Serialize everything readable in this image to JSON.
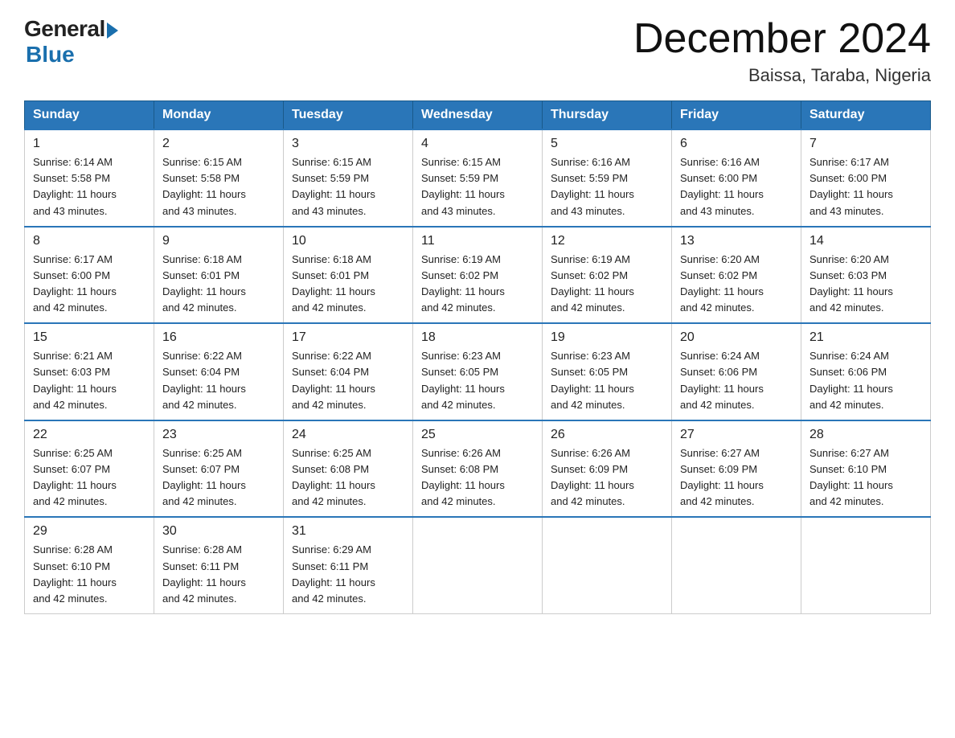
{
  "logo": {
    "general": "General",
    "blue": "Blue",
    "subtitle": "Blue"
  },
  "header": {
    "month_year": "December 2024",
    "location": "Baissa, Taraba, Nigeria"
  },
  "weekdays": [
    "Sunday",
    "Monday",
    "Tuesday",
    "Wednesday",
    "Thursday",
    "Friday",
    "Saturday"
  ],
  "weeks": [
    [
      {
        "day": "1",
        "sunrise": "6:14 AM",
        "sunset": "5:58 PM",
        "daylight": "11 hours and 43 minutes."
      },
      {
        "day": "2",
        "sunrise": "6:15 AM",
        "sunset": "5:58 PM",
        "daylight": "11 hours and 43 minutes."
      },
      {
        "day": "3",
        "sunrise": "6:15 AM",
        "sunset": "5:59 PM",
        "daylight": "11 hours and 43 minutes."
      },
      {
        "day": "4",
        "sunrise": "6:15 AM",
        "sunset": "5:59 PM",
        "daylight": "11 hours and 43 minutes."
      },
      {
        "day": "5",
        "sunrise": "6:16 AM",
        "sunset": "5:59 PM",
        "daylight": "11 hours and 43 minutes."
      },
      {
        "day": "6",
        "sunrise": "6:16 AM",
        "sunset": "6:00 PM",
        "daylight": "11 hours and 43 minutes."
      },
      {
        "day": "7",
        "sunrise": "6:17 AM",
        "sunset": "6:00 PM",
        "daylight": "11 hours and 43 minutes."
      }
    ],
    [
      {
        "day": "8",
        "sunrise": "6:17 AM",
        "sunset": "6:00 PM",
        "daylight": "11 hours and 42 minutes."
      },
      {
        "day": "9",
        "sunrise": "6:18 AM",
        "sunset": "6:01 PM",
        "daylight": "11 hours and 42 minutes."
      },
      {
        "day": "10",
        "sunrise": "6:18 AM",
        "sunset": "6:01 PM",
        "daylight": "11 hours and 42 minutes."
      },
      {
        "day": "11",
        "sunrise": "6:19 AM",
        "sunset": "6:02 PM",
        "daylight": "11 hours and 42 minutes."
      },
      {
        "day": "12",
        "sunrise": "6:19 AM",
        "sunset": "6:02 PM",
        "daylight": "11 hours and 42 minutes."
      },
      {
        "day": "13",
        "sunrise": "6:20 AM",
        "sunset": "6:02 PM",
        "daylight": "11 hours and 42 minutes."
      },
      {
        "day": "14",
        "sunrise": "6:20 AM",
        "sunset": "6:03 PM",
        "daylight": "11 hours and 42 minutes."
      }
    ],
    [
      {
        "day": "15",
        "sunrise": "6:21 AM",
        "sunset": "6:03 PM",
        "daylight": "11 hours and 42 minutes."
      },
      {
        "day": "16",
        "sunrise": "6:22 AM",
        "sunset": "6:04 PM",
        "daylight": "11 hours and 42 minutes."
      },
      {
        "day": "17",
        "sunrise": "6:22 AM",
        "sunset": "6:04 PM",
        "daylight": "11 hours and 42 minutes."
      },
      {
        "day": "18",
        "sunrise": "6:23 AM",
        "sunset": "6:05 PM",
        "daylight": "11 hours and 42 minutes."
      },
      {
        "day": "19",
        "sunrise": "6:23 AM",
        "sunset": "6:05 PM",
        "daylight": "11 hours and 42 minutes."
      },
      {
        "day": "20",
        "sunrise": "6:24 AM",
        "sunset": "6:06 PM",
        "daylight": "11 hours and 42 minutes."
      },
      {
        "day": "21",
        "sunrise": "6:24 AM",
        "sunset": "6:06 PM",
        "daylight": "11 hours and 42 minutes."
      }
    ],
    [
      {
        "day": "22",
        "sunrise": "6:25 AM",
        "sunset": "6:07 PM",
        "daylight": "11 hours and 42 minutes."
      },
      {
        "day": "23",
        "sunrise": "6:25 AM",
        "sunset": "6:07 PM",
        "daylight": "11 hours and 42 minutes."
      },
      {
        "day": "24",
        "sunrise": "6:25 AM",
        "sunset": "6:08 PM",
        "daylight": "11 hours and 42 minutes."
      },
      {
        "day": "25",
        "sunrise": "6:26 AM",
        "sunset": "6:08 PM",
        "daylight": "11 hours and 42 minutes."
      },
      {
        "day": "26",
        "sunrise": "6:26 AM",
        "sunset": "6:09 PM",
        "daylight": "11 hours and 42 minutes."
      },
      {
        "day": "27",
        "sunrise": "6:27 AM",
        "sunset": "6:09 PM",
        "daylight": "11 hours and 42 minutes."
      },
      {
        "day": "28",
        "sunrise": "6:27 AM",
        "sunset": "6:10 PM",
        "daylight": "11 hours and 42 minutes."
      }
    ],
    [
      {
        "day": "29",
        "sunrise": "6:28 AM",
        "sunset": "6:10 PM",
        "daylight": "11 hours and 42 minutes."
      },
      {
        "day": "30",
        "sunrise": "6:28 AM",
        "sunset": "6:11 PM",
        "daylight": "11 hours and 42 minutes."
      },
      {
        "day": "31",
        "sunrise": "6:29 AM",
        "sunset": "6:11 PM",
        "daylight": "11 hours and 42 minutes."
      },
      null,
      null,
      null,
      null
    ]
  ],
  "labels": {
    "sunrise": "Sunrise:",
    "sunset": "Sunset:",
    "daylight": "Daylight:"
  }
}
